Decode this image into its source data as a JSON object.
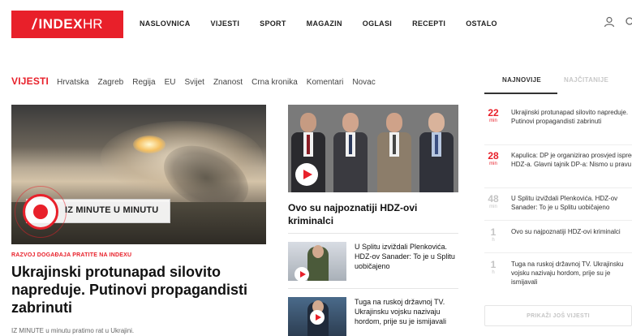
{
  "header": {
    "logo": {
      "slash": "/",
      "index": "INDEX",
      "hr": "HR"
    },
    "nav": [
      "NASLOVNICA",
      "VIJESTI",
      "SPORT",
      "MAGAZIN",
      "OGLASI",
      "RECEPTI",
      "OSTALO"
    ],
    "icons": [
      "user-icon",
      "search-icon"
    ]
  },
  "section": {
    "title": "VIJESTI",
    "subnav": [
      "Hrvatska",
      "Zagreb",
      "Regija",
      "EU",
      "Svijet",
      "Znanost",
      "Crna kronika",
      "Komentari",
      "Novac"
    ]
  },
  "sidebar_tabs": {
    "active": "NAJNOVIJE",
    "inactive": "NAJČITANIJE"
  },
  "hero": {
    "banner_text": "IZ MINUTE U MINUTU",
    "kicker": "RAZVOJ DOGAĐAJA PRATITE NA INDEXU",
    "headline": "Ukrajinski protunapad silovito napreduje. Putinovi propagandisti zabrinuti",
    "teaser": "IZ MINUTE u minutu pratimo rat u Ukrajini."
  },
  "middle": {
    "main_title": "Ovo su najpoznatiji HDZ-ovi kriminalci",
    "items": [
      {
        "title": "U Splitu izviždali Plenkovića. HDZ-ov Sanader: To je u Splitu uobičajeno"
      },
      {
        "title": "Tuga na ruskoj državnoj TV. Ukrajinsku vojsku nazivaju hordom, prije su je ismijavali"
      }
    ]
  },
  "latest": [
    {
      "num": "22",
      "unit": "min",
      "text": "Ukrajinski protunapad silovito napreduje. Putinovi propagandisti zabrinuti",
      "highlight": true
    },
    {
      "num": "28",
      "unit": "min",
      "text": "Kapulica: DP je organizirao prosvjed ispred HDZ-a. Glavni tajnik DP-a: Nismo u pravu",
      "highlight": true
    },
    {
      "num": "48",
      "unit": "min",
      "text": "U Splitu izviždali Plenkovića. HDZ-ov Sanader: To je u Splitu uobičajeno",
      "highlight": false
    },
    {
      "num": "1",
      "unit": "h",
      "text": "Ovo su najpoznatiji HDZ-ovi kriminalci",
      "highlight": false
    },
    {
      "num": "1",
      "unit": "h",
      "text": "Tuga na ruskoj državnoj TV. Ukrajinsku vojsku nazivaju hordom, prije su je ismijavali",
      "highlight": false
    }
  ],
  "more_button": "PRIKAŽI JOŠ VIJESTI",
  "colors": {
    "brand": "#e8202a",
    "muted": "#c4c4c4"
  }
}
